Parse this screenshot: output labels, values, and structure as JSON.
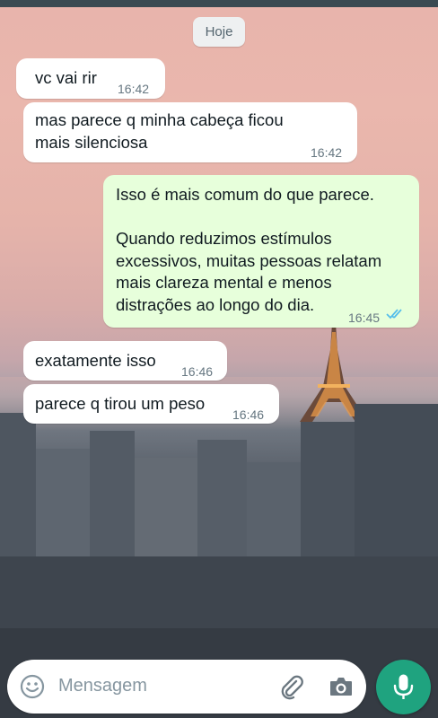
{
  "date_divider": "Hoje",
  "messages": [
    {
      "direction": "incoming",
      "text": "vc vai rir",
      "time": "16:42"
    },
    {
      "direction": "incoming",
      "text": "mas parece q minha cabeça ficou\nmais silenciosa",
      "time": "16:42"
    },
    {
      "direction": "outgoing",
      "text": "Isso é mais comum do que parece.\n\nQuando reduzimos estímulos\nexcessivos, muitas pessoas relatam\nmais clareza mental e menos\ndistrações ao longo do dia.",
      "time": "16:45",
      "status": "read"
    },
    {
      "direction": "incoming",
      "text": "exatamente isso",
      "time": "16:46"
    },
    {
      "direction": "incoming",
      "text": "parece q tirou um peso",
      "time": "16:46"
    }
  ],
  "composer": {
    "placeholder": "Mensagem",
    "icons": [
      "emoji-icon",
      "attach-icon",
      "camera-icon",
      "mic-icon"
    ]
  },
  "colors": {
    "incoming_bubble": "#ffffff",
    "outgoing_bubble": "#e7ffdb",
    "read_ticks": "#53bdeb",
    "mic_button": "#1fa37f"
  }
}
